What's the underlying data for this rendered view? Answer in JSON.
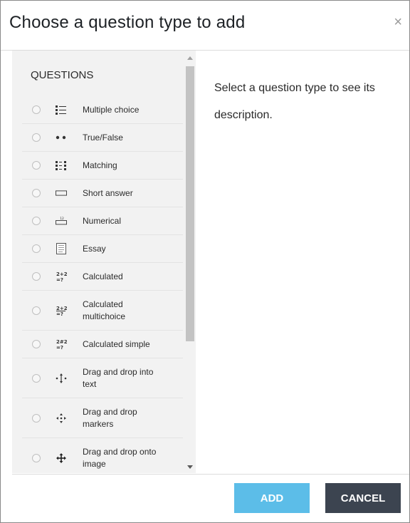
{
  "dialog": {
    "title": "Choose a question type to add",
    "close_glyph": "×"
  },
  "questions": {
    "heading": "QUESTIONS",
    "items": [
      {
        "label": "Multiple choice",
        "icon": "multiple-choice-icon"
      },
      {
        "label": "True/False",
        "icon": "true-false-icon"
      },
      {
        "label": "Matching",
        "icon": "matching-icon"
      },
      {
        "label": "Short answer",
        "icon": "short-answer-icon"
      },
      {
        "label": "Numerical",
        "icon": "numerical-icon"
      },
      {
        "label": "Essay",
        "icon": "essay-icon"
      },
      {
        "label": "Calculated",
        "icon": "calculated-icon"
      },
      {
        "label": "Calculated multichoice",
        "icon": "calculated-multichoice-icon"
      },
      {
        "label": "Calculated simple",
        "icon": "calculated-simple-icon"
      },
      {
        "label": "Drag and drop into text",
        "icon": "drag-drop-text-icon"
      },
      {
        "label": "Drag and drop markers",
        "icon": "drag-drop-markers-icon"
      },
      {
        "label": "Drag and drop onto image",
        "icon": "drag-drop-image-icon"
      }
    ]
  },
  "description": {
    "text": "Select a question type to see its description."
  },
  "footer": {
    "add_label": "ADD",
    "cancel_label": "CANCEL"
  },
  "colors": {
    "add_button": "#5cbde8",
    "cancel_button": "#3c4450",
    "list_background": "#f2f2f2"
  }
}
